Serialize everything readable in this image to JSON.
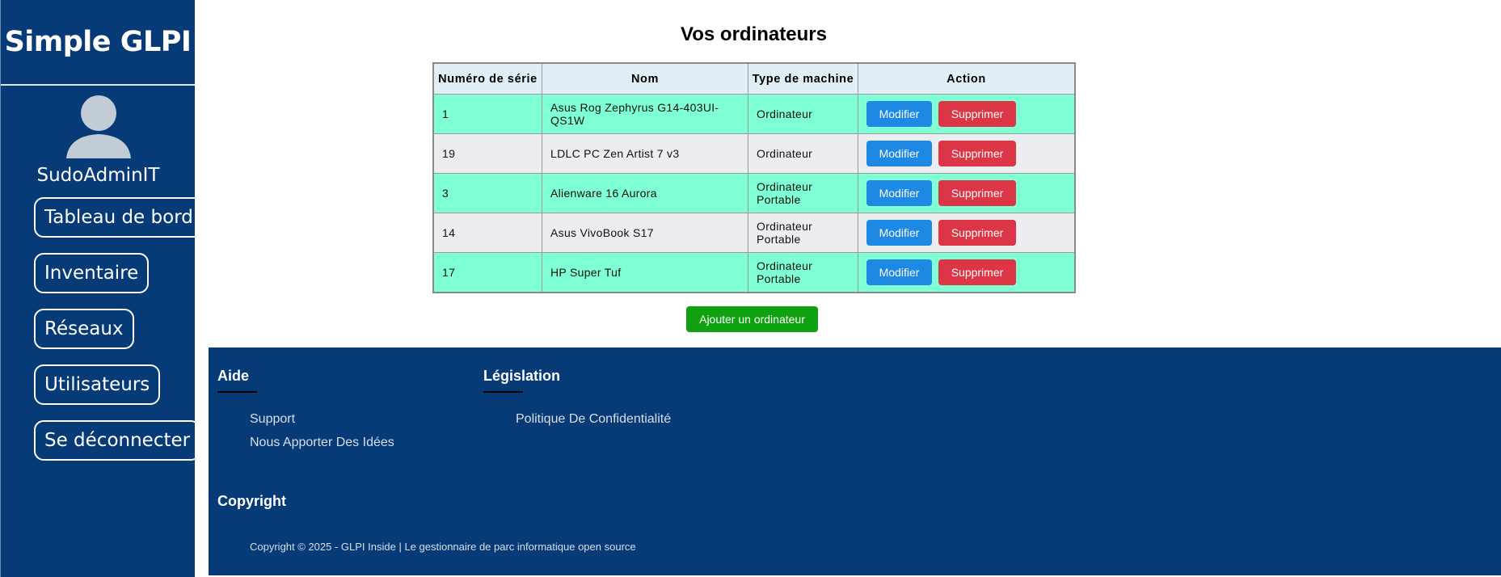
{
  "sidebar": {
    "brand": "Simple GLPI",
    "username": "SudoAdminIT",
    "nav": [
      {
        "label": "Tableau de bord"
      },
      {
        "label": "Inventaire"
      },
      {
        "label": "Réseaux"
      },
      {
        "label": "Utilisateurs"
      },
      {
        "label": "Se déconnecter"
      }
    ]
  },
  "main": {
    "title": "Vos ordinateurs",
    "table": {
      "headers": [
        "Numéro de série",
        "Nom",
        "Type de machine",
        "Action"
      ],
      "rows": [
        {
          "serial": "1",
          "name": "Asus Rog Zephyrus G14-403UI-QS1W",
          "type": "Ordinateur",
          "edit": "Modifier",
          "delete": "Supprimer"
        },
        {
          "serial": "19",
          "name": "LDLC PC Zen Artist 7 v3",
          "type": "Ordinateur",
          "edit": "Modifier",
          "delete": "Supprimer"
        },
        {
          "serial": "3",
          "name": "Alienware 16 Aurora",
          "type": "Ordinateur Portable",
          "edit": "Modifier",
          "delete": "Supprimer"
        },
        {
          "serial": "14",
          "name": "Asus VivoBook S17",
          "type": "Ordinateur Portable",
          "edit": "Modifier",
          "delete": "Supprimer"
        },
        {
          "serial": "17",
          "name": "HP Super Tuf",
          "type": "Ordinateur Portable",
          "edit": "Modifier",
          "delete": "Supprimer"
        }
      ]
    },
    "add_button": "Ajouter un ordinateur"
  },
  "footer": {
    "aide": {
      "title": "Aide",
      "links": [
        "Support",
        "Nous Apporter Des Idées"
      ]
    },
    "legislation": {
      "title": "Législation",
      "links": [
        "Politique De Confidentialité"
      ]
    },
    "copyright": {
      "title": "Copyright",
      "text": "Copyright © 2025 - GLPI Inside | Le gestionnaire de parc informatique open source"
    }
  },
  "colors": {
    "sidebar": "#063b78",
    "row_highlight": "#7fffd4",
    "row_alt": "#ebedf1",
    "edit_button": "#1e88e5",
    "delete_button": "#dc3545",
    "add_button": "#0fa10f"
  }
}
